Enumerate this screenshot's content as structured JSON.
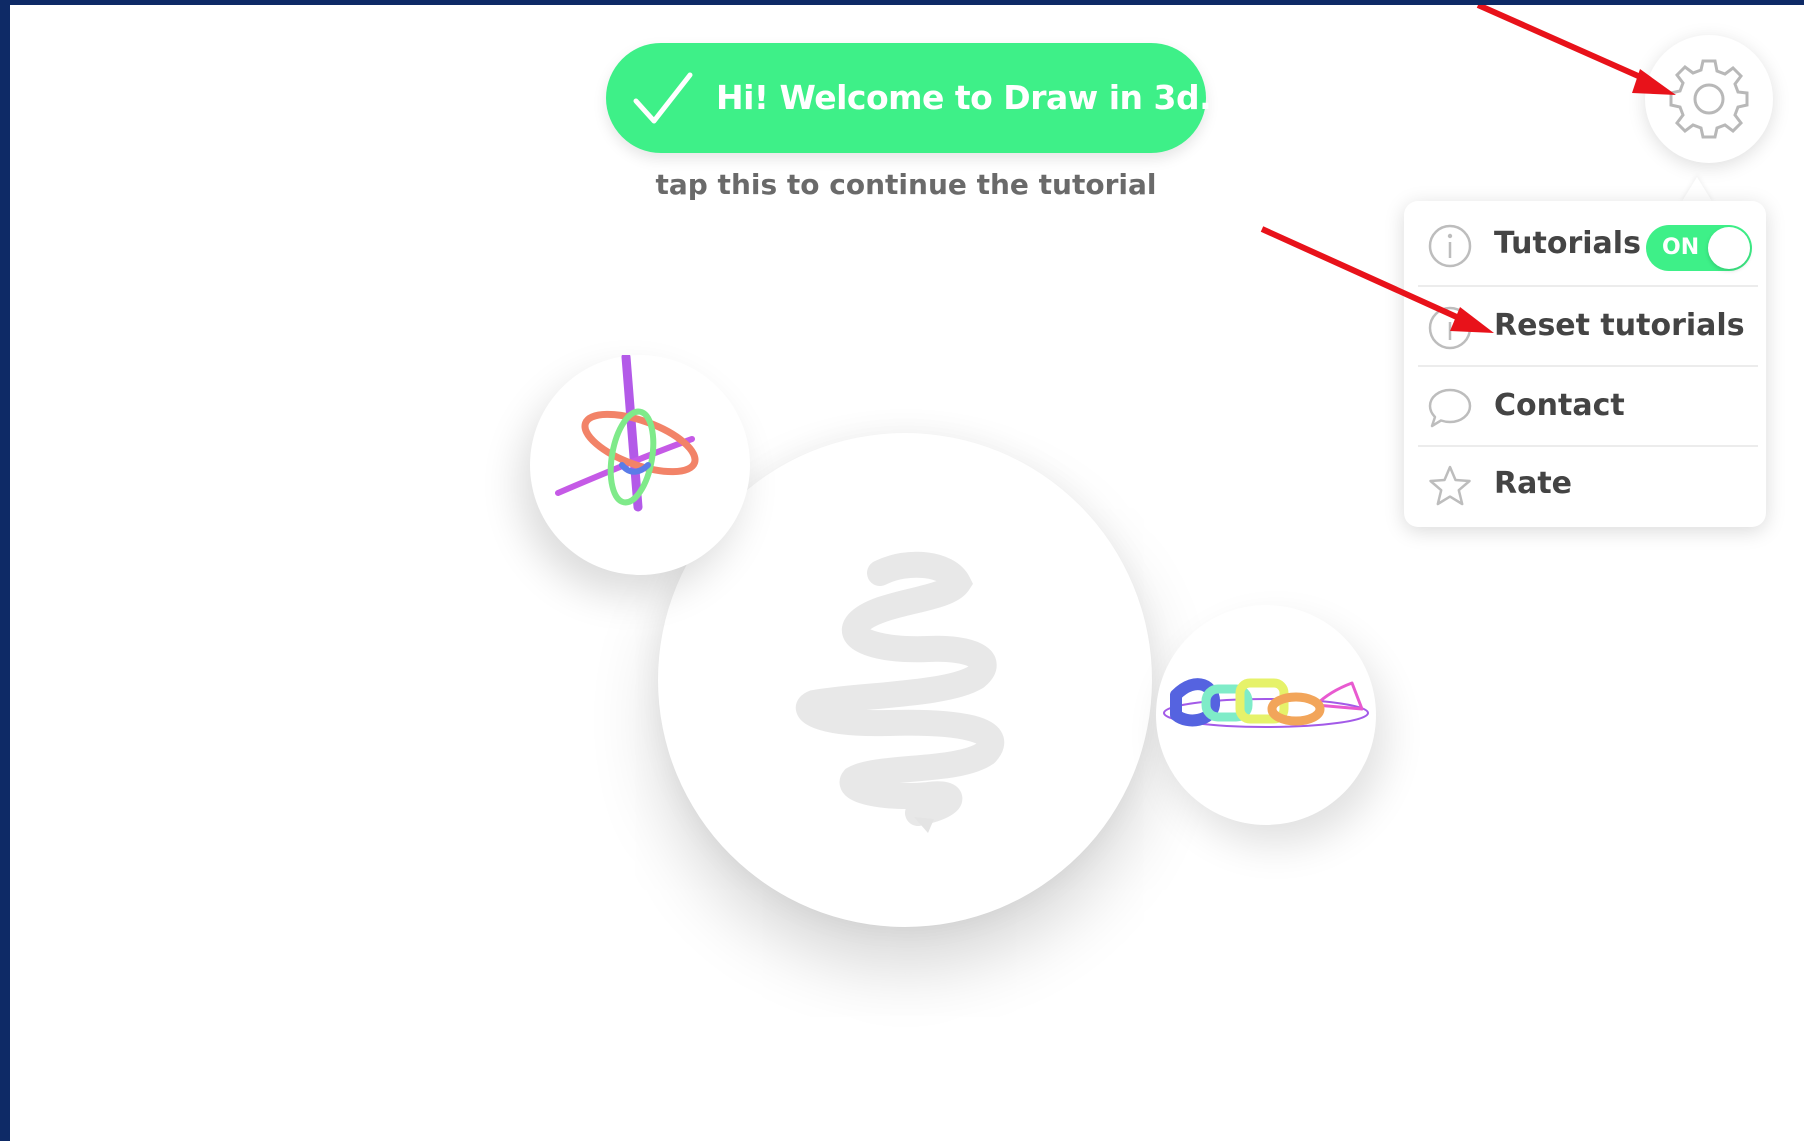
{
  "welcome": {
    "message": "Hi! Welcome to Draw in 3d.",
    "hint": "tap this to continue the tutorial"
  },
  "settings": {
    "icon": "gear-icon"
  },
  "menu": {
    "items": [
      {
        "label": "Tutorials",
        "icon": "info-icon",
        "toggle": "ON"
      },
      {
        "label": "Reset tutorials",
        "icon": "reset-icon"
      },
      {
        "label": "Contact",
        "icon": "speech-bubble-icon"
      },
      {
        "label": "Rate",
        "icon": "star-icon"
      }
    ]
  },
  "drawings": {
    "main": "new-drawing-scribble",
    "left": "saved-drawing-rings",
    "right": "saved-drawing-chain"
  },
  "colors": {
    "accent": "#3ef088",
    "annotation": "#e8121a",
    "text": "#444444",
    "subtle_text": "#6a6a6a"
  }
}
